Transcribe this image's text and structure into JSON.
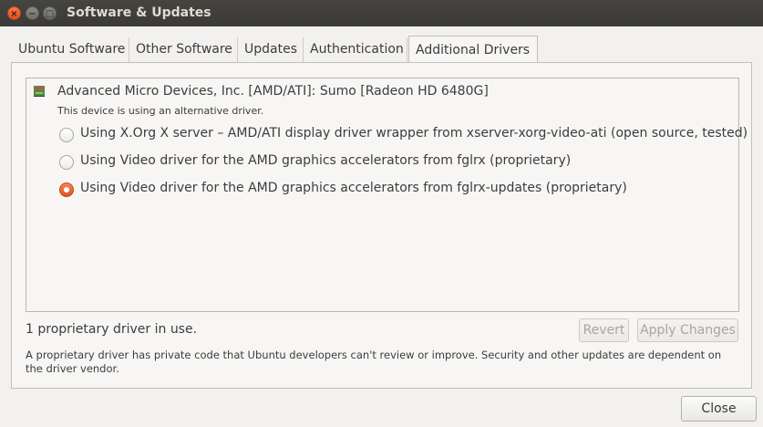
{
  "window": {
    "title": "Software & Updates"
  },
  "window_controls": {
    "close": "×",
    "minimize": "−",
    "maximize": "□"
  },
  "tabs": [
    {
      "label": "Ubuntu Software"
    },
    {
      "label": "Other Software"
    },
    {
      "label": "Updates"
    },
    {
      "label": "Authentication"
    },
    {
      "label": "Additional Drivers",
      "active": true
    }
  ],
  "device": {
    "icon": "graphics-card-icon",
    "name": "Advanced Micro Devices, Inc. [AMD/ATI]: Sumo [Radeon HD 6480G]",
    "status": "This device is using an alternative driver.",
    "options": [
      {
        "label": "Using X.Org X server – AMD/ATI display driver wrapper from xserver-xorg-video-ati (open source, tested)",
        "selected": false
      },
      {
        "label": "Using Video driver for the AMD graphics accelerators from fglrx (proprietary)",
        "selected": false
      },
      {
        "label": "Using Video driver for the AMD graphics accelerators from fglrx-updates (proprietary)",
        "selected": true
      }
    ]
  },
  "footer": {
    "in_use": "1 proprietary driver in use.",
    "revert_label": "Revert",
    "apply_label": "Apply Changes",
    "note": "A proprietary driver has private code that Ubuntu developers can't review or improve. Security and other updates are dependent on the driver vendor."
  },
  "close_label": "Close",
  "colors": {
    "accent": "#e95420",
    "titlebar": "#3c3b37"
  }
}
